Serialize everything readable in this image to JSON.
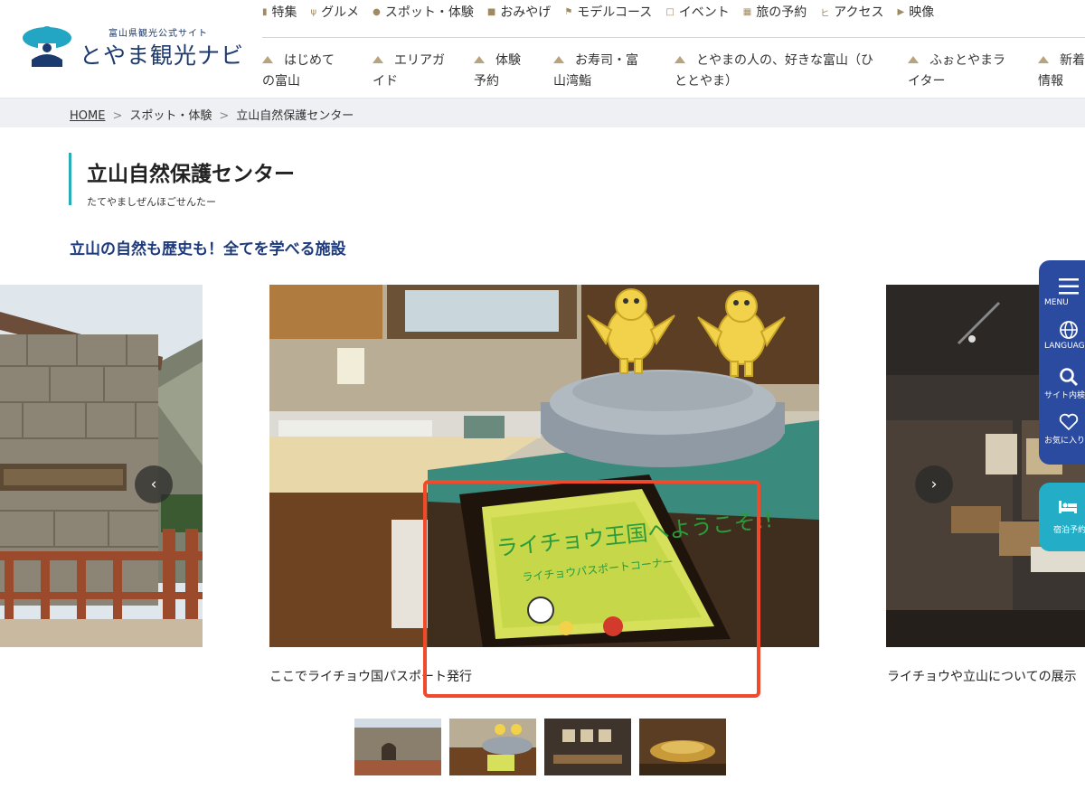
{
  "brand": {
    "sub": "富山県観光公式サイト",
    "name": "とやま観光ナビ"
  },
  "topnav": [
    {
      "label": "特集",
      "icon": "book-icon"
    },
    {
      "label": "グルメ",
      "icon": "fork-knife-icon"
    },
    {
      "label": "スポット・体験",
      "icon": "pin-icon"
    },
    {
      "label": "おみやげ",
      "icon": "bag-icon"
    },
    {
      "label": "モデルコース",
      "icon": "flag-icon"
    },
    {
      "label": "イベント",
      "icon": "calendar-icon"
    },
    {
      "label": "旅の予約",
      "icon": "building-icon"
    },
    {
      "label": "アクセス",
      "icon": "route-icon"
    },
    {
      "label": "映像",
      "icon": "play-icon"
    }
  ],
  "mainnav": [
    {
      "line1": "はじめて",
      "line2": "の富山"
    },
    {
      "line1": "エリアガ",
      "line2": "イド"
    },
    {
      "line1": "体験",
      "line2": "予約"
    },
    {
      "line1": "お寿司・富",
      "line2": "山湾鮨"
    },
    {
      "line1": "とやまの人の、好きな富山（ひ",
      "line2": "ととやま）"
    },
    {
      "line1": "ふぉとやまラ",
      "line2": "イター"
    },
    {
      "line1": "新着",
      "line2": "情報"
    }
  ],
  "breadcrumb": {
    "home": "HOME",
    "sep": ">",
    "category": "スポット・体験",
    "current": "立山自然保護センター"
  },
  "page": {
    "title": "立山自然保護センター",
    "reading": "たてやましぜんほごせんたー",
    "catch": "立山の自然も歴史も！全てを学べる施設"
  },
  "carousel": {
    "prev_glyph": "‹",
    "next_glyph": "›",
    "caption_center": "ここでライチョウ国パスポート発行",
    "caption_right": "ライチョウや立山についての展示",
    "sign_line1": "ライチョウ王国へようこそ!!",
    "sign_line2": "ライチョウパスポートコーナー",
    "slide_count": 4,
    "active_slide": 2
  },
  "dock": {
    "menu": "MENU",
    "language": "LANGUAGE",
    "search": "サイト内検索",
    "favorites": "お気に入り",
    "lodging": "宿泊予約"
  },
  "colors": {
    "navy": "#1d3a7c",
    "teal": "#27aeb7",
    "dock": "#2a4ba0",
    "lodge": "#23adc6",
    "highlight": "#ef4a2c",
    "nav_accent": "#b9a37c"
  }
}
